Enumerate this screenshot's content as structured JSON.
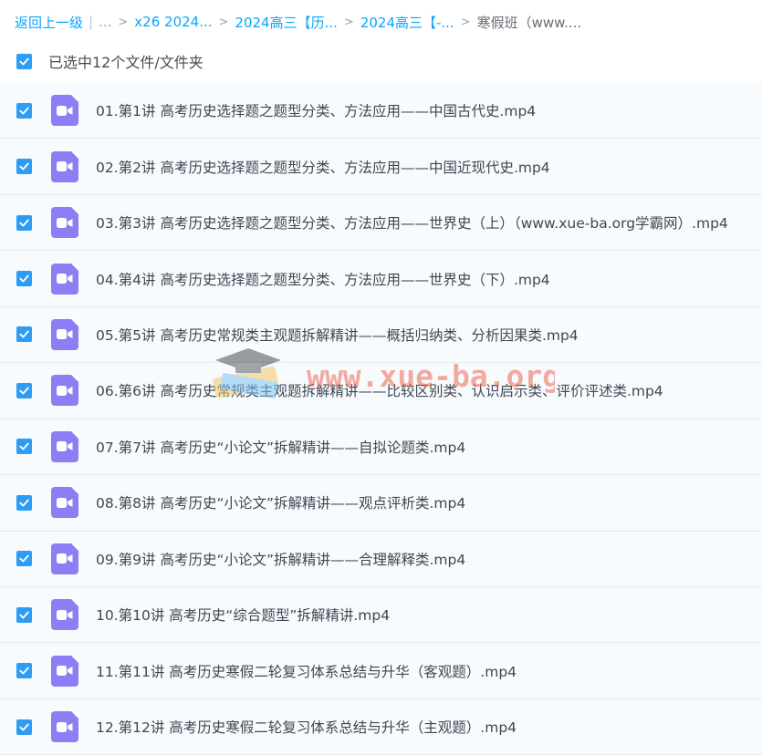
{
  "breadcrumb": {
    "back": "返回上一级",
    "ellipsis": "...",
    "items": [
      "x26 2024...",
      "2024高三【历...",
      "2024高三【-..."
    ],
    "current": "寒假班（www...."
  },
  "selection": {
    "label": "已选中12个文件/文件夹",
    "checked": true
  },
  "files": [
    "01.第1讲 高考历史选择题之题型分类、方法应用——中国古代史.mp4",
    "02.第2讲 高考历史选择题之题型分类、方法应用——中国近现代史.mp4",
    "03.第3讲 高考历史选择题之题型分类、方法应用——世界史（上）（www.xue-ba.org学霸网）.mp4",
    "04.第4讲 高考历史选择题之题型分类、方法应用——世界史（下）.mp4",
    "05.第5讲 高考历史常规类主观题拆解精讲——概括归纳类、分析因果类.mp4",
    "06.第6讲 高考历史常规类主观题拆解精讲——比较区别类、认识启示类、评价评述类.mp4",
    "07.第7讲 高考历史“小论文”拆解精讲——自拟论题类.mp4",
    "08.第8讲 高考历史“小论文”拆解精讲——观点评析类.mp4",
    "09.第9讲 高考历史“小论文”拆解精讲——合理解释类.mp4",
    "10.第10讲 高考历史“综合题型”拆解精讲.mp4",
    "11.第11讲 高考历史寒假二轮复习体系总结与升华（客观题）.mp4",
    "12.第12讲 高考历史寒假二轮复习体系总结与升华（主观题）.mp4"
  ],
  "watermark": {
    "text": "www.xue-ba.org"
  },
  "colors": {
    "accent": "#06a7ff",
    "checkbox": "#2f9cf4",
    "video_icon": "#8b7ff5",
    "row_bg": "#f7fbfe"
  },
  "icons": {
    "checkbox": "checkmark-icon",
    "file": "video-file-icon",
    "separator": "chevron-right-icon"
  }
}
